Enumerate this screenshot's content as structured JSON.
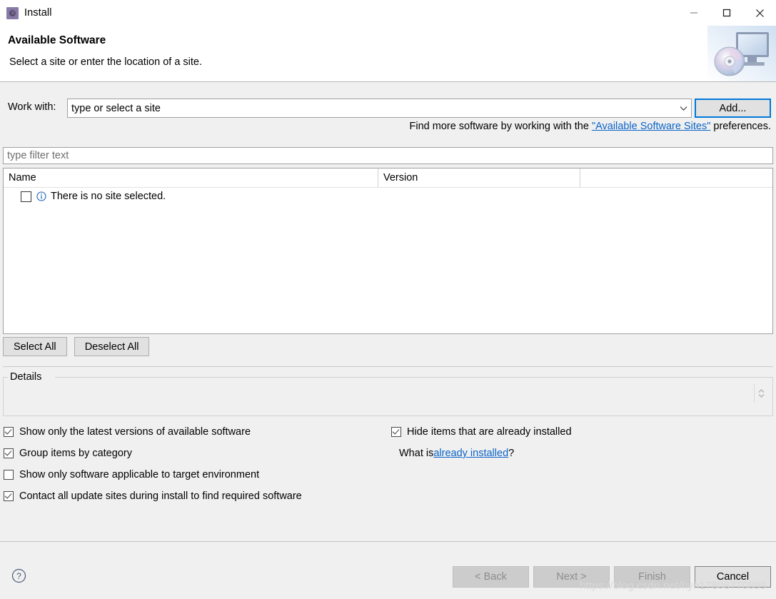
{
  "window": {
    "title": "Install",
    "icon": "install-gear-icon",
    "controls": {
      "minimize": "minimize-icon",
      "maximize": "maximize-icon",
      "close": "close-icon"
    }
  },
  "header": {
    "title": "Available Software",
    "subtitle": "Select a site or enter the location of a site.",
    "banner_icon": "monitor-with-disc-image"
  },
  "work_with": {
    "label": "Work with:",
    "value": "type or select a site",
    "placeholder": "type or select a site",
    "dropdown_icon": "chevron-down-icon",
    "add_button": "Add..."
  },
  "find_more": {
    "prefix": "Find more software by working with the ",
    "link": "\"Available Software Sites\"",
    "suffix": " preferences."
  },
  "filter": {
    "placeholder": "type filter text",
    "value": ""
  },
  "table": {
    "columns": [
      "Name",
      "Version",
      ""
    ],
    "rows": [
      {
        "checked": false,
        "icon": "info-icon",
        "name": "There is no site selected.",
        "version": ""
      }
    ]
  },
  "buttons": {
    "select_all": "Select All",
    "deselect_all": "Deselect All"
  },
  "details": {
    "legend": "Details",
    "content": "",
    "spinner_icon": "up-down-chevrons-icon"
  },
  "options": {
    "left": [
      {
        "label": "Show only the latest versions of available software",
        "checked": true
      },
      {
        "label": "Group items by category",
        "checked": true
      },
      {
        "label": "Show only software applicable to target environment",
        "checked": false
      },
      {
        "label": "Contact all update sites during install to find required software",
        "checked": true
      }
    ],
    "right": [
      {
        "label": "Hide items that are already installed",
        "checked": true
      }
    ],
    "what_is": {
      "prefix": "What is ",
      "link": "already installed",
      "suffix": "?"
    }
  },
  "footer": {
    "help_icon": "help-question-icon",
    "back": "< Back",
    "next": "Next >",
    "finish": "Finish",
    "cancel": "Cancel"
  },
  "watermark": "https://blog.csdn.net/hyh17808770899",
  "colors": {
    "accent": "#0078d7",
    "link": "#0b64c8",
    "dialog_bg": "#f0f0f0",
    "panel_bg": "#ffffff"
  }
}
